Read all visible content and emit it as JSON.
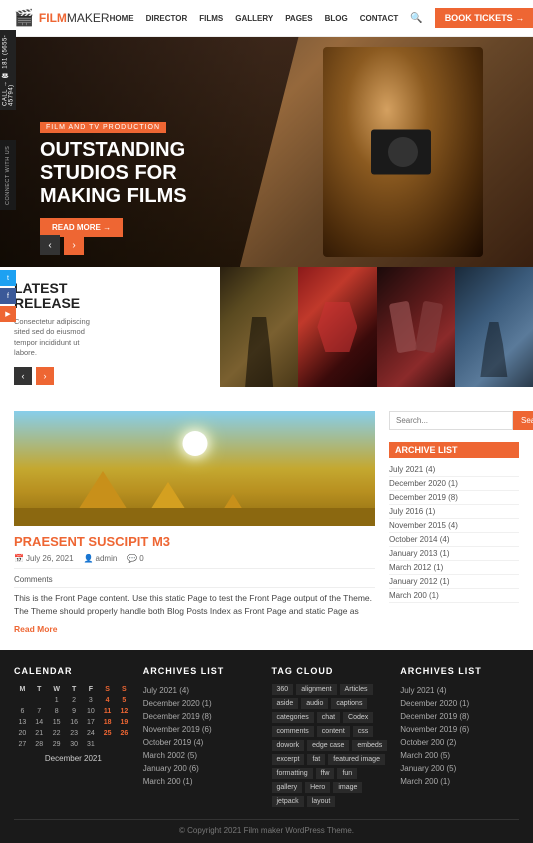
{
  "header": {
    "logo_text": "FILM",
    "logo_sub": "MAKER",
    "nav_items": [
      "HOME",
      "DIRECTOR",
      "FILMS",
      "GALLERY",
      "PAGES",
      "BLOG",
      "CONTACT"
    ],
    "book_btn": "BOOK TICKETS →"
  },
  "side": {
    "call_label": "CALL → ☎ 181 (5655-45794)",
    "connect_label": "CONNECT WITH US"
  },
  "hero": {
    "tag": "FILM AND TV PRODUCTION",
    "title": "OUTSTANDING STUDIOS FOR MAKING FILMS",
    "read_more": "READ MORE →"
  },
  "latest_release": {
    "label": "LATEST RELEASE",
    "desc": "Consectetur adipiscing sited sed do eiusmod tempor incididunt ut labore.",
    "prev": "‹",
    "next": "›"
  },
  "post": {
    "title": "PRAESENT SUSCIPIT M3",
    "date": "July 26, 2021",
    "author": "admin",
    "comments": "0",
    "comments_label": "Comments",
    "text": "This is the Front Page content. Use this static Page to test the Front Page output of the Theme. The Theme should properly handle both Blog Posts Index as Front Page and static Page as",
    "read_more": "Read More"
  },
  "sidebar": {
    "search_placeholder": "Search...",
    "search_btn": "Search",
    "archive_title": "ARCHIVE LIST",
    "archives": [
      "July 2021 (4)",
      "December 2020 (1)",
      "December 2019 (8)",
      "July 2016 (1)",
      "November 2015 (4)",
      "October 2014 (4)",
      "January 2013 (1)",
      "March 2012 (1)",
      "January 2012 (1)",
      "March 200 (1)"
    ]
  },
  "footer": {
    "calendar_title": "CALENDAR",
    "calendar_month": "December 2021",
    "calendar_headers": [
      "M",
      "T",
      "W",
      "T",
      "F",
      "S",
      "S"
    ],
    "calendar_rows": [
      [
        "",
        "",
        "1",
        "2",
        "3",
        "4",
        "5"
      ],
      [
        "6",
        "7",
        "8",
        "9",
        "10",
        "11",
        "12"
      ],
      [
        "13",
        "14",
        "15",
        "16",
        "17",
        "18",
        "19"
      ],
      [
        "20",
        "21",
        "22",
        "23",
        "24",
        "25",
        "26"
      ],
      [
        "27",
        "28",
        "29",
        "30",
        "31",
        "",
        ""
      ]
    ],
    "archives_title": "ARCHIVES LIST",
    "archives_col1": [
      "July 2021 (4)",
      "December 2020 (1)",
      "December 2019 (8)",
      "November 2019 (6)",
      "October 2019 (4)",
      "March 2002 (5)",
      "January 200 (6)",
      "March 200 (1)"
    ],
    "tagcloud_title": "TAG CLOUD",
    "tags": [
      "360",
      "alignment",
      "Articles",
      "aside",
      "audio",
      "captions",
      "categories",
      "chat",
      "Codex",
      "comments",
      "content",
      "css",
      "dowork",
      "edge case",
      "embeds",
      "excerpt",
      "fat",
      "featured image",
      "formatting",
      "ffw",
      "fun",
      "gallery",
      "Hero",
      "image",
      "jetpack",
      "layout"
    ],
    "archives_title2": "ARCHIVES LIST",
    "archives_col2": [
      "July 2021 (4)",
      "December 2020 (1)",
      "December 2019 (8)",
      "November 2019 (6)",
      "October 200 (2)",
      "March 200 (5)",
      "January 200 (5)",
      "March 200 (1)"
    ],
    "copyright": "© Copyright 2021 Film maker WordPress Theme."
  }
}
